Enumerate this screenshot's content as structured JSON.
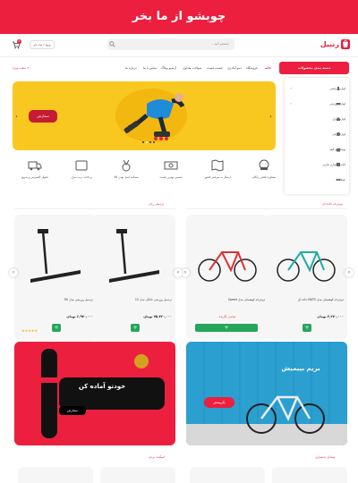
{
  "banner": {
    "title": "چوبشو از ما بخر"
  },
  "header": {
    "logo_text": "زنبیل",
    "search_placeholder": "جستجو کنید...",
    "login_label": "ورود / ثبت نام",
    "cart_count": "0"
  },
  "nav": {
    "categories_label": "دسته بندی محصولات",
    "items": [
      "خانه",
      "فروشگاه",
      "دمو آمادزی",
      "لیست قیمت",
      "سوالات متداول",
      "آرشیو وبلاگ",
      "تماس با ما",
      "درباره ما"
    ],
    "location_label": "شعب ویژه"
  },
  "dropdown": {
    "items": [
      "لوازم آرایشی",
      "لوازم ورزشی",
      "لوازم منزل",
      "لوازم برقی",
      "پوشاک و کیف",
      "لوازم جانبی",
      "کتاب و لوازم تحریر",
      "عینک",
      "سایر"
    ]
  },
  "hero": {
    "button_label": "سفارش",
    "dots": 4
  },
  "services": [
    "مشاوره تلفنی رایگان",
    "ارسال به سراسر کشور",
    "تضمین بهترین قیمت",
    "ضمانت اصل بودن کالا",
    "پرداخت درب منزل",
    "تحویل اکسپرس و سریع"
  ],
  "sections": {
    "left_title": "تردمیل زنان",
    "right_title": "دوچرخه جاده ای"
  },
  "products": [
    {
      "name": "دوچرخه کوهستان مدل MATS جاده ای",
      "price": "۳,۲۷۰,۰۰۰ تومان",
      "action": "+",
      "stock": ""
    },
    {
      "name": "دوچرخه کوهستان مدل Speed",
      "price": "",
      "action": "+",
      "stock": "تمامی نگزیده"
    },
    {
      "name": "تردمیل ورزشی خانگی مدل 15",
      "price": "۷۵,۷۲۰,۰۰۰ تومان",
      "action": "+",
      "stock": ""
    },
    {
      "name": "تردمیل ورزشی مدل Tel",
      "price": "۶,۹۷۰,۰۰۰ تومان",
      "action": "+",
      "stock": "",
      "rating": "★★★★★"
    }
  ],
  "promos": {
    "left_text": "خودتو آماده کن",
    "left_button": "سفارش",
    "right_text": "بریم بپیمیش",
    "right_button": "بگرپیمش"
  },
  "bottom": {
    "left_title": "اسکیت بردی",
    "right_title": "وسایل بدنسازی"
  },
  "colors": {
    "brand": "#ec1f3f",
    "hero_bg": "#f8c820",
    "promo_blue": "#2a9fd0",
    "add_green": "#26a65b"
  }
}
